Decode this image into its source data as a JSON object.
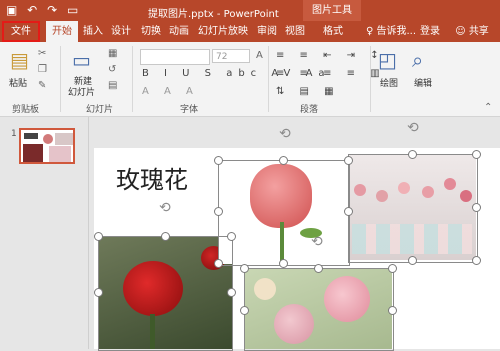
{
  "app": {
    "document_title": "提取图片.pptx - PowerPoint",
    "contextual_tab_group": "图片工具"
  },
  "qat": {
    "save_icon": "save-icon",
    "undo_icon": "undo-icon",
    "redo_icon": "redo-icon",
    "present_icon": "present-icon"
  },
  "tabs": [
    {
      "label": "文件"
    },
    {
      "label": "开始"
    },
    {
      "label": "插入"
    },
    {
      "label": "设计"
    },
    {
      "label": "切换"
    },
    {
      "label": "动画"
    },
    {
      "label": "幻灯片放映"
    },
    {
      "label": "审阅"
    },
    {
      "label": "视图"
    },
    {
      "label": "格式"
    }
  ],
  "tell_me": "♀ 告诉我...",
  "signin": "登录",
  "share": "共享",
  "ribbon": {
    "paste": "粘贴",
    "new_slide_line1": "新建",
    "new_slide_line2": "幻灯片",
    "font_size": "72",
    "drawing": "绘图",
    "editing": "编辑",
    "groups": {
      "clipboard": "剪贴板",
      "slides": "幻灯片",
      "font": "字体",
      "paragraph": "段落"
    }
  },
  "thumbnails": {
    "slide_number": "1"
  },
  "slide": {
    "title": "玫瑰花"
  },
  "colors": {
    "accent": "#b7472a",
    "tab_active_text": "#b7472a",
    "highlight": "#e41b17"
  }
}
